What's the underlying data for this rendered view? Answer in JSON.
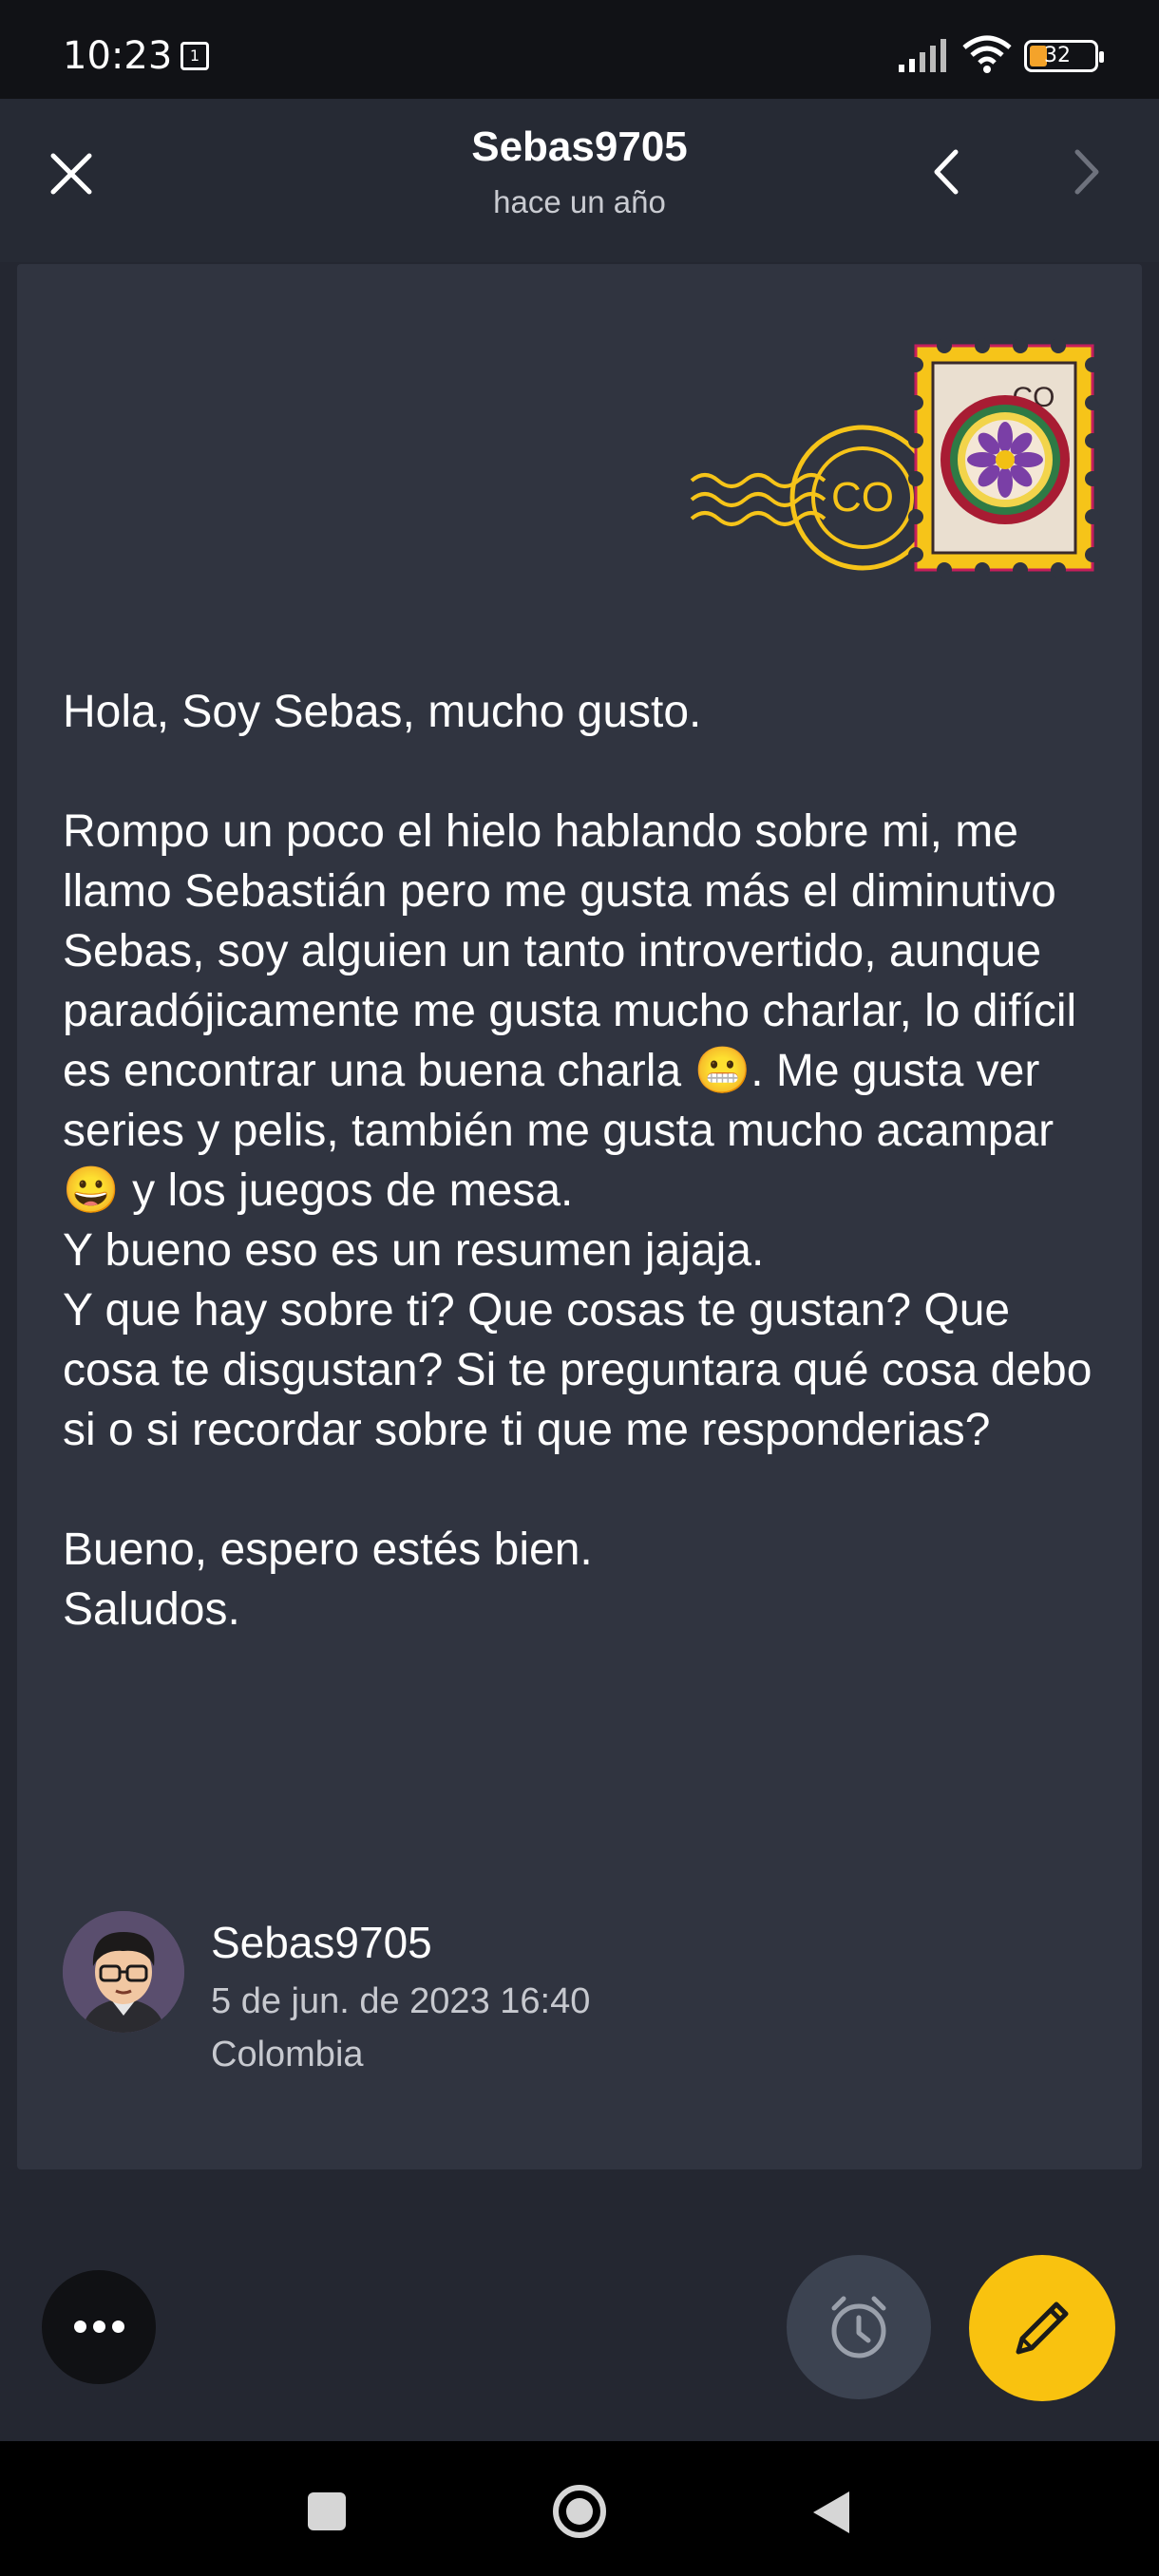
{
  "status_bar": {
    "time": "10:23",
    "sim_badge": "1",
    "battery": "32"
  },
  "header": {
    "title": "Sebas9705",
    "subtitle": "hace un año"
  },
  "stamp": {
    "code": "CO"
  },
  "letter": {
    "body": "Hola, Soy Sebas, mucho gusto.\n\nRompo un poco el hielo hablando sobre mi, me llamo Sebastián pero me gusta más el diminutivo Sebas, soy alguien un tanto introvertido, aunque paradójicamente me gusta mucho charlar, lo difícil es encontrar una buena charla 😬. Me gusta ver series y pelis, también me gusta mucho acampar 😀 y los juegos de mesa.\nY bueno eso es un resumen jajaja.\nY que hay sobre ti? Que cosas te gustan? Que cosa te disgustan? Si te preguntara qué cosa debo si o si recordar sobre ti que me responderias?\n\nBueno, espero estés bien.\nSaludos."
  },
  "signature": {
    "author": "Sebas9705",
    "date": "5 de jun. de 2023 16:40",
    "country": "Colombia"
  },
  "icons": {
    "close": "close-icon",
    "prev": "chevron-left-icon",
    "next": "chevron-right-icon",
    "more": "more-icon",
    "alarm": "alarm-clock-icon",
    "edit": "pencil-icon"
  },
  "colors": {
    "background": "#242731",
    "card": "#303440",
    "accent": "#f9c20f",
    "stamp_red": "#a81c33"
  }
}
